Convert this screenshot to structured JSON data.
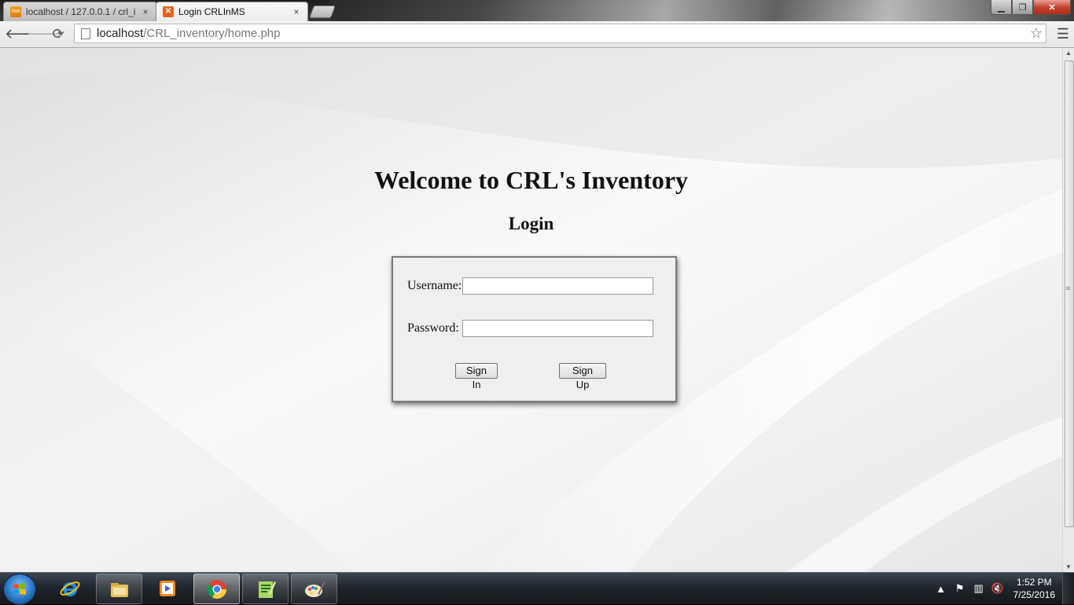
{
  "browser": {
    "tabs": [
      {
        "title": "localhost / 127.0.0.1 / crl_i",
        "favicon": "phpmyadmin-icon",
        "favicon_text": "PMA",
        "active": false
      },
      {
        "title": "Login CRLInMS",
        "favicon": "xampp-icon",
        "active": true
      }
    ],
    "close_glyph": "×",
    "address": {
      "host": "localhost",
      "path": "/CRL_inventory/home.php"
    }
  },
  "page": {
    "heading": "Welcome to CRL's Inventory",
    "subheading": "Login",
    "form": {
      "username_label": "Username:",
      "username_value": "",
      "password_label": "Password:",
      "password_value": "",
      "sign_in_label": "Sign In",
      "sign_up_label": "Sign Up"
    }
  },
  "taskbar": {
    "apps": [
      "internet-explorer-icon",
      "file-explorer-icon",
      "media-player-icon",
      "chrome-icon",
      "notepad-plus-plus-icon",
      "paint-icon"
    ],
    "clock": {
      "time": "1:52 PM",
      "date": "7/25/2016"
    }
  },
  "colors": {
    "xampp": "#e8641b",
    "close_button": "#c7432e",
    "taskbar": "#20262c"
  }
}
